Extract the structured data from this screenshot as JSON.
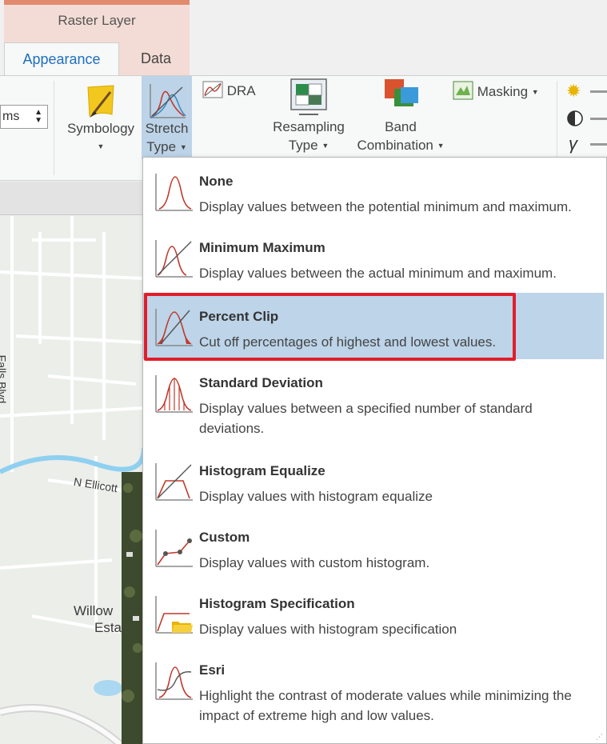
{
  "ribbon": {
    "context_group": "Raster Layer",
    "tabs": [
      {
        "label": "Appearance",
        "active": true
      },
      {
        "label": "Data",
        "active": false
      }
    ],
    "spinner_text": "ms",
    "symbology": {
      "label": "Symbology"
    },
    "stretch_type": {
      "line1": "Stretch",
      "line2": "Type",
      "active": true
    },
    "dra": {
      "label": "DRA"
    },
    "resampling": {
      "line1": "Resampling",
      "line2": "Type"
    },
    "band": {
      "line1": "Band",
      "line2": "Combination"
    },
    "masking": {
      "label": "Masking"
    },
    "enhance_icons": [
      "brightness-icon",
      "contrast-icon",
      "gamma-icon"
    ],
    "gamma_glyph": "γ"
  },
  "map": {
    "labels": [
      "Falls Blvd",
      "N Ellicott",
      "Willow",
      "Esta"
    ]
  },
  "stretch_menu": {
    "items": [
      {
        "icon": "none-stretch-icon",
        "title": "None",
        "desc": "Display values between the potential minimum and maximum.",
        "selected": false
      },
      {
        "icon": "minmax-stretch-icon",
        "title": "Minimum Maximum",
        "desc": "Display values between the actual minimum and maximum.",
        "selected": false
      },
      {
        "icon": "percent-clip-icon",
        "title": "Percent Clip",
        "desc": "Cut off percentages of highest and lowest values.",
        "selected": true
      },
      {
        "icon": "std-dev-icon",
        "title": "Standard Deviation",
        "desc": "Display values between a specified number of standard deviations.",
        "selected": false
      },
      {
        "icon": "histogram-equalize-icon",
        "title": "Histogram Equalize",
        "desc": "Display values with histogram equalize",
        "selected": false
      },
      {
        "icon": "custom-stretch-icon",
        "title": "Custom",
        "desc": "Display values with custom histogram.",
        "selected": false
      },
      {
        "icon": "histogram-spec-icon",
        "title": "Histogram Specification",
        "desc": "Display values with histogram specification",
        "selected": false
      },
      {
        "icon": "esri-stretch-icon",
        "title": "Esri",
        "desc": "Highlight the contrast of moderate values while minimizing the impact of extreme high and low values.",
        "selected": false
      }
    ]
  },
  "colors": {
    "accent_tab": "#1f6fbf",
    "selection": "#bdd4e9",
    "highlight_border": "#e21d2b",
    "curve": "#c0392b"
  }
}
